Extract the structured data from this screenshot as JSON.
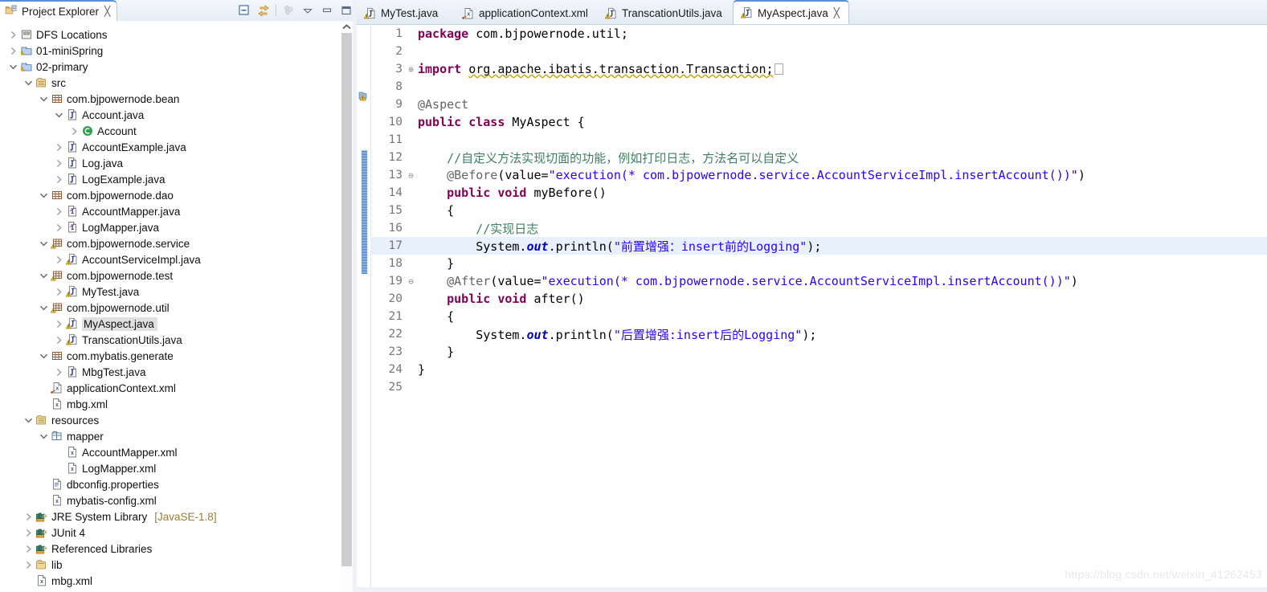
{
  "explorer": {
    "tab_title": "Project Explorer",
    "close_glyph": "╳",
    "toolbar": [
      {
        "name": "collapse-all-icon",
        "tip": "Collapse All"
      },
      {
        "name": "link-with-editor-icon",
        "tip": "Link with Editor"
      },
      {
        "name": "view-menu-icon",
        "tip": "View Menu"
      },
      {
        "name": "chevron-down-icon",
        "tip": "Minimize Menu"
      },
      {
        "name": "minimize-icon",
        "tip": "Minimize"
      },
      {
        "name": "maximize-icon",
        "tip": "Maximize"
      }
    ],
    "tree": [
      {
        "depth": 0,
        "twisty": "collapsed",
        "icon": "dfs-locations-icon",
        "label": "DFS Locations",
        "selected": false
      },
      {
        "depth": 0,
        "twisty": "collapsed",
        "icon": "java-project-icon",
        "label": "01-miniSpring",
        "selected": false
      },
      {
        "depth": 0,
        "twisty": "expanded",
        "icon": "java-project-icon",
        "label": "02-primary",
        "selected": false
      },
      {
        "depth": 1,
        "twisty": "expanded",
        "icon": "source-folder-icon",
        "label": "src",
        "selected": false
      },
      {
        "depth": 2,
        "twisty": "expanded",
        "icon": "package-icon",
        "label": "com.bjpowernode.bean",
        "selected": false
      },
      {
        "depth": 3,
        "twisty": "expanded",
        "icon": "java-file-icon",
        "label": "Account.java",
        "selected": false
      },
      {
        "depth": 4,
        "twisty": "collapsed",
        "icon": "class-icon",
        "label": "Account",
        "selected": false
      },
      {
        "depth": 3,
        "twisty": "collapsed",
        "icon": "java-file-icon",
        "label": "AccountExample.java",
        "selected": false
      },
      {
        "depth": 3,
        "twisty": "collapsed",
        "icon": "java-file-icon",
        "label": "Log.java",
        "selected": false
      },
      {
        "depth": 3,
        "twisty": "collapsed",
        "icon": "java-file-icon",
        "label": "LogExample.java",
        "selected": false
      },
      {
        "depth": 2,
        "twisty": "expanded",
        "icon": "package-icon",
        "label": "com.bjpowernode.dao",
        "selected": false
      },
      {
        "depth": 3,
        "twisty": "collapsed",
        "icon": "java-interface-icon",
        "label": "AccountMapper.java",
        "selected": false
      },
      {
        "depth": 3,
        "twisty": "collapsed",
        "icon": "java-interface-icon",
        "label": "LogMapper.java",
        "selected": false
      },
      {
        "depth": 2,
        "twisty": "expanded",
        "icon": "package-warning-icon",
        "label": "com.bjpowernode.service",
        "selected": false
      },
      {
        "depth": 3,
        "twisty": "collapsed",
        "icon": "java-file-warning-icon",
        "label": "AccountServiceImpl.java",
        "selected": false
      },
      {
        "depth": 2,
        "twisty": "expanded",
        "icon": "package-warning-icon",
        "label": "com.bjpowernode.test",
        "selected": false
      },
      {
        "depth": 3,
        "twisty": "collapsed",
        "icon": "java-file-warning-icon",
        "label": "MyTest.java",
        "selected": false
      },
      {
        "depth": 2,
        "twisty": "expanded",
        "icon": "package-warning-icon",
        "label": "com.bjpowernode.util",
        "selected": false
      },
      {
        "depth": 3,
        "twisty": "collapsed",
        "icon": "java-file-warning-icon",
        "label": "MyAspect.java",
        "selected": true
      },
      {
        "depth": 3,
        "twisty": "collapsed",
        "icon": "java-file-warning-icon",
        "label": "TranscationUtils.java",
        "selected": false
      },
      {
        "depth": 2,
        "twisty": "expanded",
        "icon": "package-icon",
        "label": "com.mybatis.generate",
        "selected": false
      },
      {
        "depth": 3,
        "twisty": "collapsed",
        "icon": "java-file-icon",
        "label": "MbgTest.java",
        "selected": false
      },
      {
        "depth": 2,
        "twisty": "none",
        "icon": "xml-spring-icon",
        "label": "applicationContext.xml",
        "selected": false
      },
      {
        "depth": 2,
        "twisty": "none",
        "icon": "xml-file-icon",
        "label": "mbg.xml",
        "selected": false
      },
      {
        "depth": 1,
        "twisty": "expanded",
        "icon": "source-folder-icon",
        "label": "resources",
        "selected": false
      },
      {
        "depth": 2,
        "twisty": "expanded",
        "icon": "folder-package-icon",
        "label": "mapper",
        "selected": false
      },
      {
        "depth": 3,
        "twisty": "none",
        "icon": "xml-file-icon",
        "label": "AccountMapper.xml",
        "selected": false
      },
      {
        "depth": 3,
        "twisty": "none",
        "icon": "xml-file-icon",
        "label": "LogMapper.xml",
        "selected": false
      },
      {
        "depth": 2,
        "twisty": "none",
        "icon": "properties-file-icon",
        "label": "dbconfig.properties",
        "selected": false
      },
      {
        "depth": 2,
        "twisty": "none",
        "icon": "xml-file-icon",
        "label": "mybatis-config.xml",
        "selected": false
      },
      {
        "depth": 1,
        "twisty": "collapsed",
        "icon": "library-icon",
        "label": "JRE System Library",
        "suffix": "[JavaSE-1.8]",
        "selected": false
      },
      {
        "depth": 1,
        "twisty": "collapsed",
        "icon": "library-icon",
        "label": "JUnit 4",
        "selected": false
      },
      {
        "depth": 1,
        "twisty": "collapsed",
        "icon": "library-icon",
        "label": "Referenced Libraries",
        "selected": false
      },
      {
        "depth": 1,
        "twisty": "collapsed",
        "icon": "folder-icon",
        "label": "lib",
        "selected": false
      },
      {
        "depth": 1,
        "twisty": "none",
        "icon": "xml-file-icon",
        "label": "mbg.xml",
        "selected": false
      }
    ]
  },
  "editor": {
    "tabs": [
      {
        "label": "MyTest.java",
        "icon": "java-file-warning-icon",
        "active": false,
        "closable": false
      },
      {
        "label": "applicationContext.xml",
        "icon": "xml-spring-icon",
        "active": false,
        "closable": false
      },
      {
        "label": "TranscationUtils.java",
        "icon": "java-file-warning-icon",
        "active": false,
        "closable": false
      },
      {
        "label": "MyAspect.java",
        "icon": "java-file-warning-icon",
        "active": true,
        "closable": true
      }
    ],
    "close_glyph": "╳",
    "highlighted_line": 17,
    "lines": [
      {
        "num": "1",
        "fold": "",
        "text": "package com.bjpowernode.util;"
      },
      {
        "num": "2",
        "fold": "",
        "text": ""
      },
      {
        "num": "3",
        "fold": "⊕",
        "text": "import org.apache.ibatis.transaction.Transaction;"
      },
      {
        "num": "8",
        "fold": "",
        "text": ""
      },
      {
        "num": "9",
        "fold": "",
        "text": "@Aspect"
      },
      {
        "num": "10",
        "fold": "",
        "text": "public class MyAspect {"
      },
      {
        "num": "11",
        "fold": "",
        "text": ""
      },
      {
        "num": "12",
        "fold": "",
        "text": "    //自定义方法实现切面的功能，例如打印日志，方法名可以自定义"
      },
      {
        "num": "13",
        "fold": "⊖",
        "text": "    @Before(value=\"execution(* com.bjpowernode.service.AccountServiceImpl.insertAccount())\")"
      },
      {
        "num": "14",
        "fold": "",
        "text": "    public void myBefore()"
      },
      {
        "num": "15",
        "fold": "",
        "text": "    {"
      },
      {
        "num": "16",
        "fold": "",
        "text": "        //实现日志"
      },
      {
        "num": "17",
        "fold": "",
        "text": "        System.out.println(\"前置增强：insert前的Logging\");"
      },
      {
        "num": "18",
        "fold": "",
        "text": "    }"
      },
      {
        "num": "19",
        "fold": "⊖",
        "text": "    @After(value=\"execution(* com.bjpowernode.service.AccountServiceImpl.insertAccount())\")"
      },
      {
        "num": "20",
        "fold": "",
        "text": "    public void after()"
      },
      {
        "num": "21",
        "fold": "",
        "text": "    {"
      },
      {
        "num": "22",
        "fold": "",
        "text": "        System.out.println(\"后置增强:insert后的Logging\");"
      },
      {
        "num": "23",
        "fold": "",
        "text": "    }"
      },
      {
        "num": "24",
        "fold": "",
        "text": "}"
      },
      {
        "num": "25",
        "fold": "",
        "text": ""
      }
    ]
  },
  "watermark": "https://blog.csdn.net/weixin_41262453",
  "colors": {
    "keyword": "#7f0055",
    "string": "#2a00ff",
    "comment": "#3f7f5f",
    "annotation": "#646464",
    "field": "#0000c0",
    "tab_accent": "#5a8fd6",
    "line_highlight": "#e8f0fb",
    "selection": "#e0e0e0"
  }
}
